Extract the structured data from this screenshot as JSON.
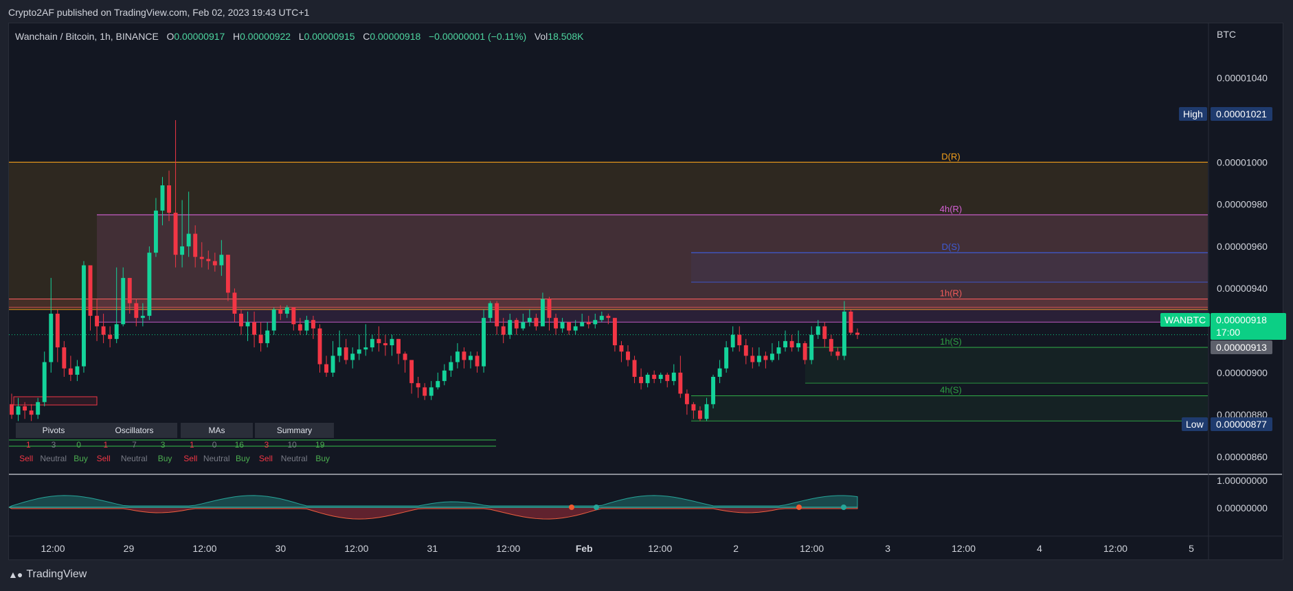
{
  "publisher": "Crypto2AF published on TradingView.com, Feb 02, 2023 19:43 UTC+1",
  "legend": {
    "symbol": "Wanchain / Bitcoin, 1h, BINANCE",
    "o_label": "O",
    "o": "0.00000917",
    "h_label": "H",
    "h": "0.00000922",
    "l_label": "L",
    "l": "0.00000915",
    "c_label": "C",
    "c": "0.00000918",
    "change": "−0.00000001 (−0.11%)",
    "vol_label": "Vol",
    "vol": "18.508K"
  },
  "price_scale": {
    "unit": "BTC",
    "ticks": [
      "0.00001040",
      "0.00001000",
      "0.00000980",
      "0.00000960",
      "0.00000940",
      "0.00000900",
      "0.00000880",
      "0.00000860"
    ],
    "tick_values": [
      10.4,
      10.0,
      9.8,
      9.6,
      9.4,
      9.0,
      8.8,
      8.6
    ],
    "high_label": "High",
    "high_value": "0.00001021",
    "low_label": "Low",
    "low_value": "0.00000877",
    "symbol_tag": "WANBTC",
    "last_price": "0.00000918",
    "countdown": "17:00",
    "other_price": "0.00000913"
  },
  "osc_scale": {
    "ticks": [
      "1.00000000",
      "0.00000000"
    ]
  },
  "time_axis": [
    "12:00",
    "29",
    "12:00",
    "30",
    "12:00",
    "31",
    "12:00",
    "Feb",
    "12:00",
    "2",
    "12:00",
    "3",
    "12:00",
    "4",
    "12:00",
    "5"
  ],
  "zones": [
    {
      "label": "D(R)",
      "color": "#f7a21b",
      "top": 10.0,
      "bottom": 9.3
    },
    {
      "label": "4h(R)",
      "color": "#d561d6",
      "top": 9.75,
      "bottom": 9.24
    },
    {
      "label": "D(S)",
      "color": "#3f5bd6",
      "top": 9.57,
      "bottom": 9.43
    },
    {
      "label": "1h(R)",
      "color": "#f05a5a",
      "top": 9.35,
      "bottom": 9.31
    },
    {
      "label": "1h(S)",
      "color": "#2ea043",
      "top": 9.12,
      "bottom": 8.95
    },
    {
      "label": "4h(S)",
      "color": "#2ea043",
      "top": 8.89,
      "bottom": 8.77
    }
  ],
  "pivot_table": {
    "sections": [
      {
        "title": "Pivots",
        "counts": [
          "1",
          "3",
          "0"
        ],
        "labels": [
          "Sell",
          "Neutral",
          "Buy"
        ]
      },
      {
        "title": "Oscillators",
        "counts": [
          "1",
          "7",
          "3"
        ],
        "labels": [
          "Sell",
          "Neutral",
          "Buy"
        ]
      },
      {
        "title": "MAs",
        "counts": [
          "1",
          "0",
          "16"
        ],
        "labels": [
          "Sell",
          "Neutral",
          "Buy"
        ]
      },
      {
        "title": "Summary",
        "counts": [
          "3",
          "10",
          "19"
        ],
        "labels": [
          "Sell",
          "Neutral",
          "Buy"
        ]
      }
    ]
  },
  "chart_data": {
    "type": "candlestick",
    "title": "Wanchain / Bitcoin, 1h, BINANCE",
    "unit_note": "prices in 1e-6 BTC",
    "ylim": [
      8.52,
      10.66
    ],
    "candles": [
      [
        8.85,
        8.8,
        8.9,
        8.78
      ],
      [
        8.8,
        8.84,
        8.88,
        8.77
      ],
      [
        8.84,
        8.82,
        8.86,
        8.78
      ],
      [
        8.82,
        8.8,
        8.85,
        8.77
      ],
      [
        8.8,
        8.86,
        8.88,
        8.78
      ],
      [
        8.86,
        9.05,
        9.1,
        8.84
      ],
      [
        9.05,
        9.28,
        9.45,
        9.0
      ],
      [
        9.28,
        9.12,
        9.3,
        9.05
      ],
      [
        9.12,
        9.02,
        9.15,
        8.98
      ],
      [
        9.02,
        8.99,
        9.08,
        8.96
      ],
      [
        8.99,
        9.03,
        9.06,
        8.96
      ],
      [
        9.03,
        9.51,
        9.53,
        9.0
      ],
      [
        9.51,
        9.27,
        9.51,
        9.2
      ],
      [
        9.27,
        9.22,
        9.35,
        9.15
      ],
      [
        9.22,
        9.18,
        9.28,
        9.14
      ],
      [
        9.18,
        9.16,
        9.22,
        9.12
      ],
      [
        9.16,
        9.23,
        9.5,
        9.14
      ],
      [
        9.23,
        9.45,
        9.5,
        9.22
      ],
      [
        9.45,
        9.33,
        9.45,
        9.28
      ],
      [
        9.33,
        9.26,
        9.35,
        9.22
      ],
      [
        9.26,
        9.27,
        9.33,
        9.22
      ],
      [
        9.27,
        9.57,
        9.6,
        9.25
      ],
      [
        9.57,
        9.77,
        9.83,
        9.55
      ],
      [
        9.77,
        9.89,
        9.93,
        9.7
      ],
      [
        9.89,
        9.76,
        9.96,
        9.72
      ],
      [
        9.76,
        9.56,
        10.2,
        9.5
      ],
      [
        9.56,
        9.6,
        9.82,
        9.5
      ],
      [
        9.6,
        9.66,
        9.86,
        9.55
      ],
      [
        9.66,
        9.55,
        9.7,
        9.5
      ],
      [
        9.55,
        9.54,
        9.62,
        9.5
      ],
      [
        9.54,
        9.53,
        9.58,
        9.49
      ],
      [
        9.53,
        9.51,
        9.57,
        9.48
      ],
      [
        9.51,
        9.56,
        9.63,
        9.46
      ],
      [
        9.56,
        9.38,
        9.56,
        9.34
      ],
      [
        9.38,
        9.28,
        9.4,
        9.24
      ],
      [
        9.28,
        9.22,
        9.3,
        9.18
      ],
      [
        9.22,
        9.24,
        9.29,
        9.15
      ],
      [
        9.24,
        9.18,
        9.29,
        9.12
      ],
      [
        9.18,
        9.14,
        9.24,
        9.1
      ],
      [
        9.14,
        9.2,
        9.24,
        9.12
      ],
      [
        9.2,
        9.3,
        9.31,
        9.18
      ],
      [
        9.3,
        9.28,
        9.32,
        9.25
      ],
      [
        9.28,
        9.31,
        9.32,
        9.26
      ],
      [
        9.31,
        9.23,
        9.31,
        9.2
      ],
      [
        9.23,
        9.2,
        9.26,
        9.18
      ],
      [
        9.2,
        9.25,
        9.27,
        9.18
      ],
      [
        9.25,
        9.21,
        9.27,
        9.16
      ],
      [
        9.21,
        9.04,
        9.23,
        9.0
      ],
      [
        9.04,
        9.0,
        9.08,
        8.98
      ],
      [
        9.0,
        9.08,
        9.15,
        8.98
      ],
      [
        9.08,
        9.12,
        9.2,
        9.05
      ],
      [
        9.12,
        9.06,
        9.16,
        9.04
      ],
      [
        9.06,
        9.09,
        9.12,
        9.02
      ],
      [
        9.09,
        9.11,
        9.18,
        9.06
      ],
      [
        9.11,
        9.12,
        9.23,
        9.08
      ],
      [
        9.12,
        9.16,
        9.18,
        9.1
      ],
      [
        9.16,
        9.14,
        9.22,
        9.1
      ],
      [
        9.14,
        9.13,
        9.18,
        9.08
      ],
      [
        9.13,
        9.16,
        9.18,
        9.08
      ],
      [
        9.16,
        9.09,
        9.16,
        9.04
      ],
      [
        9.09,
        9.06,
        9.1,
        9.0
      ],
      [
        9.06,
        8.95,
        9.06,
        8.9
      ],
      [
        8.95,
        8.93,
        8.98,
        8.88
      ],
      [
        8.93,
        8.89,
        8.95,
        8.87
      ],
      [
        8.89,
        8.93,
        8.96,
        8.87
      ],
      [
        8.93,
        8.96,
        9.0,
        8.92
      ],
      [
        8.96,
        9.01,
        9.04,
        8.94
      ],
      [
        9.01,
        9.05,
        9.08,
        8.98
      ],
      [
        9.05,
        9.1,
        9.14,
        9.02
      ],
      [
        9.1,
        9.06,
        9.12,
        9.02
      ],
      [
        9.06,
        9.08,
        9.1,
        9.02
      ],
      [
        9.08,
        9.03,
        9.1,
        9.0
      ],
      [
        9.03,
        9.26,
        9.3,
        9.0
      ],
      [
        9.26,
        9.33,
        9.34,
        9.24
      ],
      [
        9.33,
        9.22,
        9.34,
        9.18
      ],
      [
        9.22,
        9.18,
        9.26,
        9.14
      ],
      [
        9.18,
        9.25,
        9.28,
        9.16
      ],
      [
        9.25,
        9.21,
        9.26,
        9.18
      ],
      [
        9.21,
        9.24,
        9.28,
        9.2
      ],
      [
        9.24,
        9.26,
        9.3,
        9.22
      ],
      [
        9.26,
        9.22,
        9.28,
        9.2
      ],
      [
        9.22,
        9.35,
        9.38,
        9.22
      ],
      [
        9.35,
        9.26,
        9.36,
        9.2
      ],
      [
        9.26,
        9.21,
        9.28,
        9.18
      ],
      [
        9.21,
        9.24,
        9.26,
        9.19
      ],
      [
        9.24,
        9.2,
        9.24,
        9.18
      ],
      [
        9.2,
        9.22,
        9.25,
        9.18
      ],
      [
        9.22,
        9.24,
        9.28,
        9.22
      ],
      [
        9.24,
        9.23,
        9.27,
        9.21
      ],
      [
        9.23,
        9.25,
        9.28,
        9.21
      ],
      [
        9.25,
        9.27,
        9.29,
        9.24
      ],
      [
        9.27,
        9.26,
        9.28,
        9.23
      ],
      [
        9.26,
        9.13,
        9.26,
        9.1
      ],
      [
        9.13,
        9.1,
        9.15,
        9.05
      ],
      [
        9.1,
        9.06,
        9.13,
        9.03
      ],
      [
        9.06,
        8.98,
        9.08,
        8.95
      ],
      [
        8.98,
        8.95,
        9.02,
        8.92
      ],
      [
        8.95,
        8.99,
        9.0,
        8.93
      ],
      [
        8.99,
        8.97,
        9.01,
        8.95
      ],
      [
        8.97,
        8.99,
        9.0,
        8.95
      ],
      [
        8.99,
        8.96,
        9.0,
        8.93
      ],
      [
        8.96,
        9.0,
        9.04,
        8.94
      ],
      [
        9.0,
        8.9,
        9.08,
        8.88
      ],
      [
        8.9,
        8.85,
        8.92,
        8.8
      ],
      [
        8.85,
        8.82,
        8.86,
        8.78
      ],
      [
        8.82,
        8.78,
        8.84,
        8.77
      ],
      [
        8.78,
        8.85,
        8.88,
        8.77
      ],
      [
        8.85,
        8.98,
        8.99,
        8.83
      ],
      [
        8.98,
        9.02,
        9.06,
        8.95
      ],
      [
        9.02,
        9.12,
        9.15,
        9.0
      ],
      [
        9.12,
        9.18,
        9.22,
        9.1
      ],
      [
        9.18,
        9.13,
        9.22,
        9.1
      ],
      [
        9.13,
        9.08,
        9.16,
        9.04
      ],
      [
        9.08,
        9.05,
        9.12,
        9.02
      ],
      [
        9.05,
        9.08,
        9.12,
        9.03
      ],
      [
        9.08,
        9.06,
        9.1,
        9.02
      ],
      [
        9.06,
        9.09,
        9.14,
        9.05
      ],
      [
        9.09,
        9.12,
        9.15,
        9.06
      ],
      [
        9.12,
        9.15,
        9.2,
        9.1
      ],
      [
        9.15,
        9.12,
        9.18,
        9.1
      ],
      [
        9.12,
        9.14,
        9.2,
        9.1
      ],
      [
        9.14,
        9.06,
        9.15,
        9.04
      ],
      [
        9.06,
        9.18,
        9.22,
        9.04
      ],
      [
        9.18,
        9.22,
        9.25,
        9.16
      ],
      [
        9.22,
        9.16,
        9.24,
        9.12
      ],
      [
        9.16,
        9.1,
        9.18,
        9.08
      ],
      [
        9.1,
        9.08,
        9.12,
        9.06
      ],
      [
        9.08,
        9.29,
        9.34,
        9.06
      ],
      [
        9.29,
        9.19,
        9.3,
        9.18
      ],
      [
        9.19,
        9.18,
        9.21,
        9.16
      ]
    ]
  },
  "footer": {
    "brand": "TradingView"
  },
  "colors": {
    "up": "#26a69a",
    "up_bright": "#14d39a",
    "down": "#f23645",
    "bg": "#131722",
    "accent_blue": "#2962ff"
  }
}
